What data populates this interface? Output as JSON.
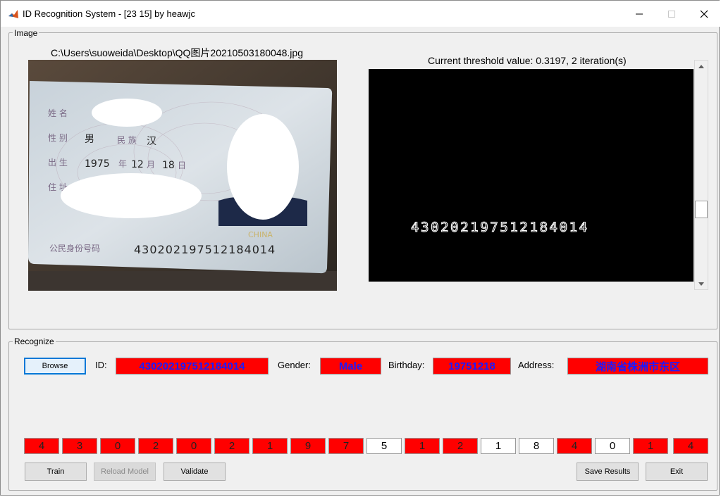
{
  "window": {
    "title": "ID Recognition System - [23 15] by heawjc"
  },
  "image_panel": {
    "legend": "Image",
    "file_path": "C:\\Users\\suoweida\\Desktop\\QQ图片20210503180048.jpg",
    "threshold_text": "Current threshold value: 0.3197, 2 iteration(s)",
    "binary_digits": "430202197512184014",
    "card": {
      "name_label": "姓 名",
      "gender_label": "性 别",
      "gender_value": "男",
      "ethnicity_label": "民 族",
      "ethnicity_value": "汉",
      "birth_label": "出 生",
      "birth_year": "1975",
      "birth_year_unit": "年",
      "birth_month": "12",
      "birth_month_unit": "月",
      "birth_day": "18",
      "birth_day_unit": "日",
      "address_label": "住 址",
      "id_label": "公民身份号码",
      "id_number": "430202197512184014",
      "china_text": "CHINA"
    }
  },
  "recognize_panel": {
    "legend": "Recognize",
    "browse_label": "Browse",
    "id_label": "ID:",
    "id_value": "430202197512184014",
    "gender_label": "Gender:",
    "gender_value": "Male",
    "birthday_label": "Birthday:",
    "birthday_value": "19751218",
    "address_label": "Address:",
    "address_value": "湖南省株洲市东区",
    "digits": [
      {
        "value": "4",
        "highlight": "red"
      },
      {
        "value": "3",
        "highlight": "red"
      },
      {
        "value": "0",
        "highlight": "red"
      },
      {
        "value": "2",
        "highlight": "red"
      },
      {
        "value": "0",
        "highlight": "red"
      },
      {
        "value": "2",
        "highlight": "red"
      },
      {
        "value": "1",
        "highlight": "red"
      },
      {
        "value": "9",
        "highlight": "red"
      },
      {
        "value": "7",
        "highlight": "red"
      },
      {
        "value": "5",
        "highlight": "white"
      },
      {
        "value": "1",
        "highlight": "red"
      },
      {
        "value": "2",
        "highlight": "red"
      },
      {
        "value": "1",
        "highlight": "white"
      },
      {
        "value": "8",
        "highlight": "white"
      },
      {
        "value": "4",
        "highlight": "red"
      },
      {
        "value": "0",
        "highlight": "white"
      },
      {
        "value": "1",
        "highlight": "red"
      },
      {
        "value": "4",
        "highlight": "red"
      }
    ],
    "train_label": "Train",
    "reload_label": "Reload Model",
    "validate_label": "Validate",
    "save_label": "Save Results",
    "exit_label": "Exit"
  },
  "colors": {
    "highlight_red": "#ff0000",
    "text_blue": "#1a1aff"
  }
}
